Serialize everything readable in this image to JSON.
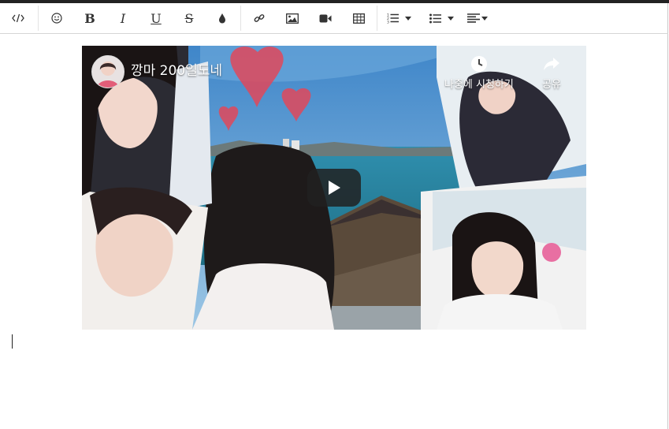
{
  "toolbar": {
    "buttons": [
      {
        "name": "code-view-button",
        "icon": "code-icon"
      },
      {
        "name": "emoji-button",
        "icon": "smiley-icon"
      },
      {
        "name": "bold-button",
        "label": "B"
      },
      {
        "name": "italic-button",
        "label": "I"
      },
      {
        "name": "underline-button",
        "label": "U"
      },
      {
        "name": "strikethrough-button",
        "label": "S"
      },
      {
        "name": "color-button",
        "icon": "ink-drop-icon"
      },
      {
        "name": "link-button",
        "icon": "link-icon"
      },
      {
        "name": "image-button",
        "icon": "image-icon"
      },
      {
        "name": "video-button",
        "icon": "video-camera-icon"
      },
      {
        "name": "table-button",
        "icon": "table-icon"
      },
      {
        "name": "ordered-list-button",
        "icon": "ordered-list-icon"
      },
      {
        "name": "unordered-list-button",
        "icon": "unordered-list-icon"
      },
      {
        "name": "align-button",
        "icon": "align-left-icon"
      }
    ],
    "bold_label": "B",
    "italic_label": "I",
    "underline_label": "U",
    "strike_label": "S"
  },
  "video": {
    "title": "깡마 200일도네",
    "watch_later_label": "나중에 시청하기",
    "share_label": "공유",
    "colors": {
      "sky": "#5b9bd5",
      "sea": "#2d8aa6",
      "heart": "#e0485a"
    }
  }
}
